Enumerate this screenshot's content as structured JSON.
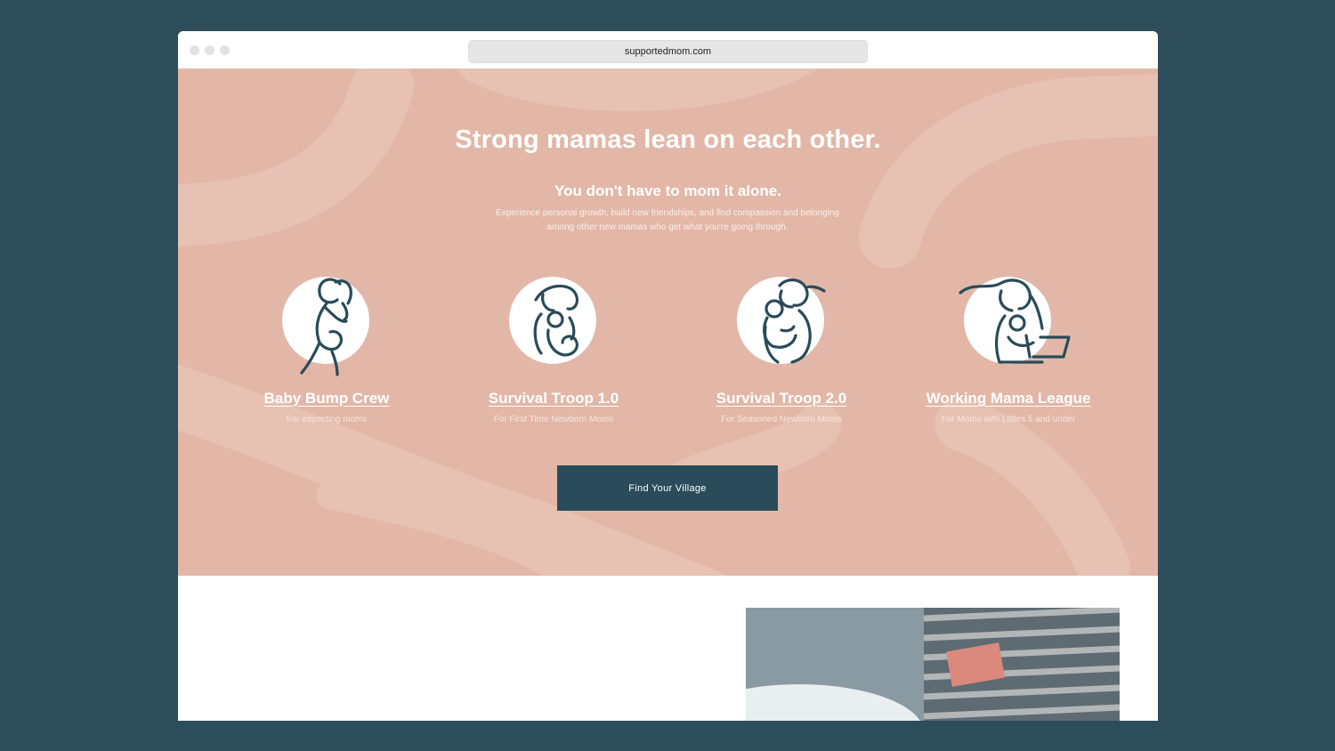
{
  "browser": {
    "url": "supportedmom.com"
  },
  "hero": {
    "headline": "Strong mamas lean on each other.",
    "subhead": "You don't have to mom it alone.",
    "description": "Experience personal growth, build new friendships, and find compassion and belonging among other new mamas who get what you're going through.",
    "cta_label": "Find Your Village"
  },
  "groups": [
    {
      "title": "Baby Bump Crew",
      "subtitle": "For expecting moms",
      "icon": "pregnant-mom-icon"
    },
    {
      "title": "Survival Troop 1.0",
      "subtitle": "For First Time Newborn Moms",
      "icon": "mom-with-newborn-icon"
    },
    {
      "title": "Survival Troop 2.0",
      "subtitle": "For Seasoned Newborn Moms",
      "icon": "mom-with-baby-icon"
    },
    {
      "title": "Working Mama League",
      "subtitle": "For Moms with Littles 5 and under",
      "icon": "working-mom-laptop-icon"
    }
  ],
  "colors": {
    "page_background": "#2e4d5a",
    "hero_background": "#e2b7a7",
    "brush_strokes": "#e8c3b5",
    "accent": "#2a4b59",
    "text_on_hero": "#ffffff"
  }
}
